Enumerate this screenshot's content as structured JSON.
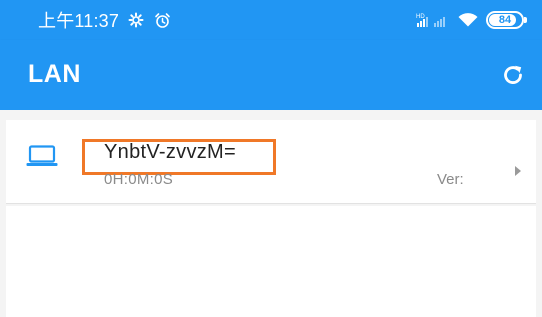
{
  "status_bar": {
    "time": "上午11:37",
    "battery_level": "84",
    "battery_fraction": 0.84,
    "icons": [
      "gear-icon",
      "alarm-icon",
      "signal-icon",
      "wifi-icon",
      "battery-icon"
    ]
  },
  "app_bar": {
    "title": "LAN",
    "refresh_icon": "refresh-icon"
  },
  "devices": [
    {
      "name": "YnbtV-zvvzM=",
      "uptime": "0H:0M:0S",
      "version": "Ver:",
      "icon": "laptop-icon",
      "highlighted": true
    }
  ],
  "colors": {
    "primary": "#2196f3",
    "highlight_border": "#f07828",
    "secondary_text": "#8a8a8a",
    "background": "#f4f4f4"
  }
}
